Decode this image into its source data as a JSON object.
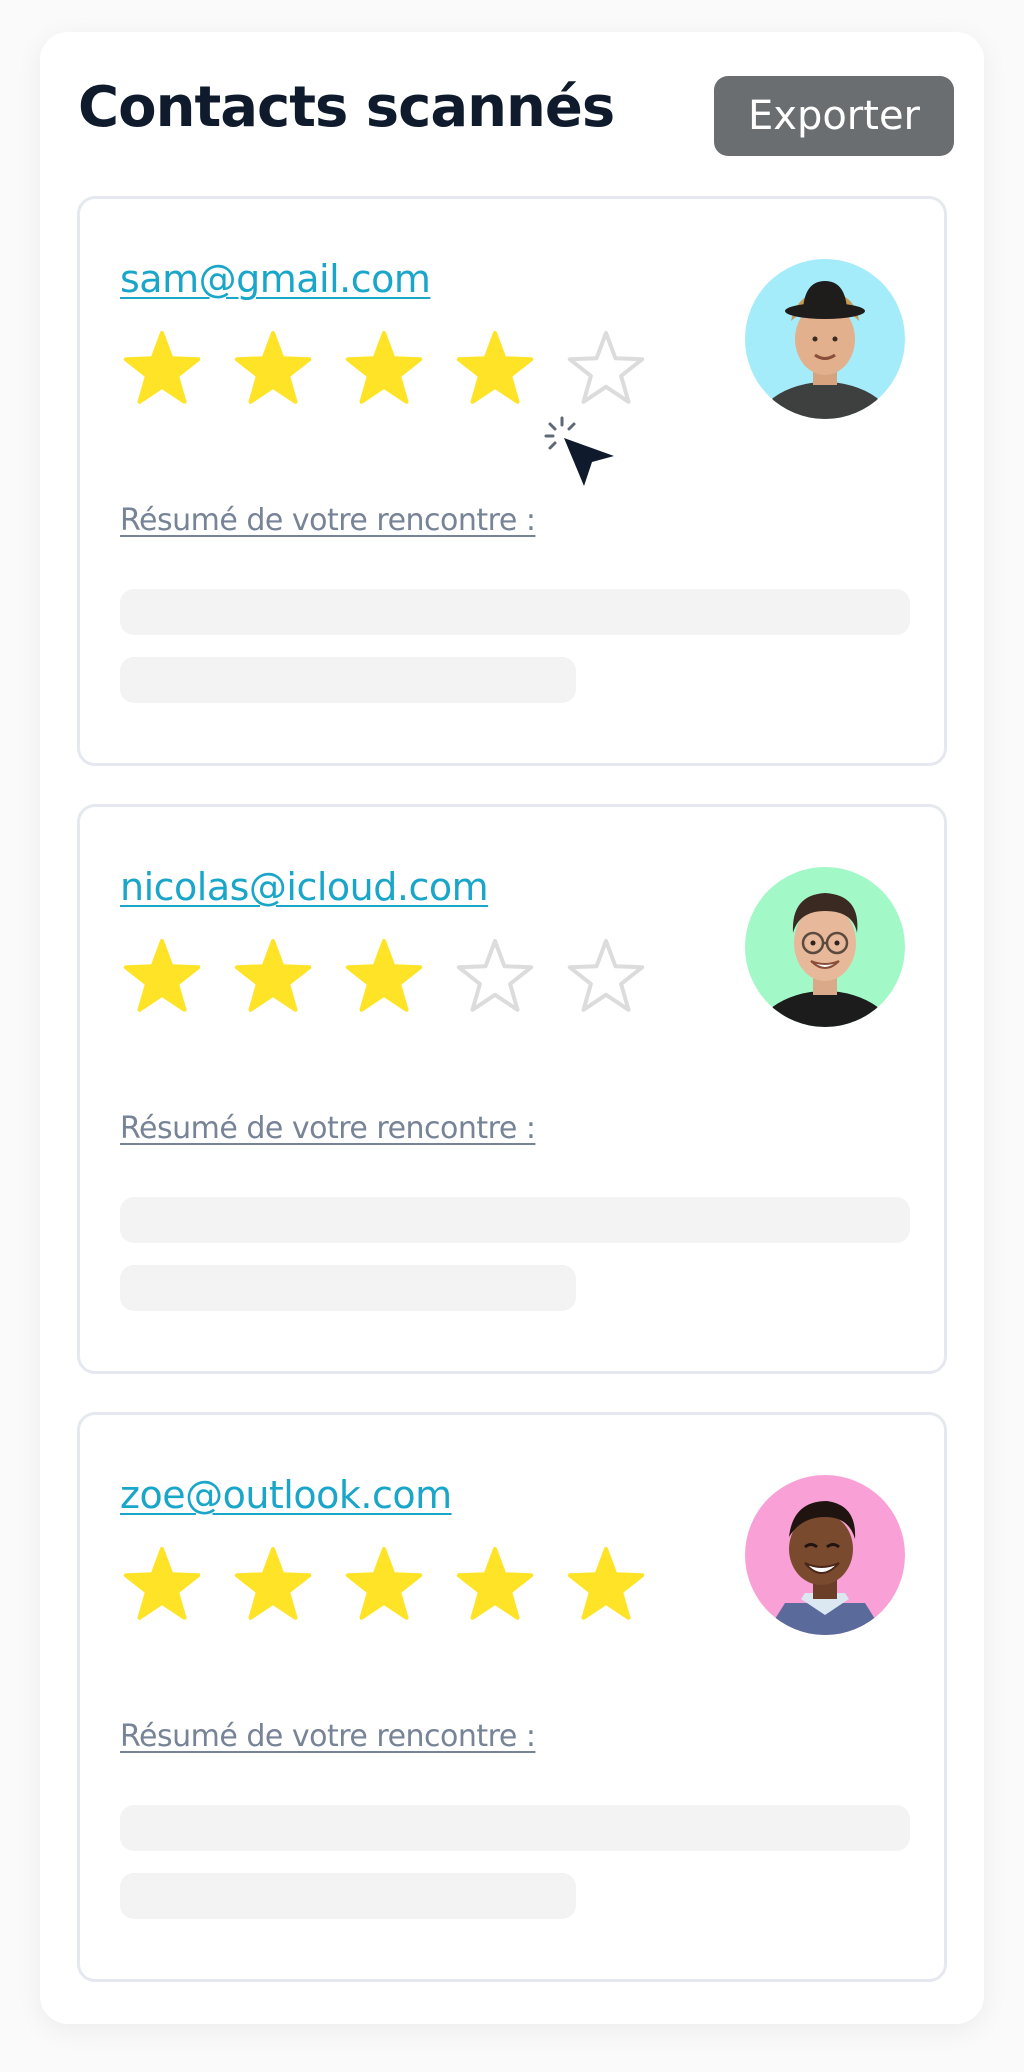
{
  "header": {
    "title": "Contacts scannés",
    "export_label": "Exporter"
  },
  "contacts": [
    {
      "email": "sam@gmail.com",
      "rating": 4,
      "max_rating": 5,
      "summary_label": "Résumé de votre rencontre :",
      "avatar_bg": "#a5ecfb"
    },
    {
      "email": "nicolas@icloud.com",
      "rating": 3,
      "max_rating": 5,
      "summary_label": "Résumé de votre rencontre :",
      "avatar_bg": "#a3f8c8"
    },
    {
      "email": "zoe@outlook.com",
      "rating": 5,
      "max_rating": 5,
      "summary_label": "Résumé de votre rencontre :",
      "avatar_bg": "#f9a1d6"
    }
  ],
  "icons": {
    "star_filled": "star-filled-icon",
    "star_empty": "star-empty-icon",
    "cursor": "mouse-pointer-icon"
  },
  "colors": {
    "star_filled": "#fee327",
    "star_empty_stroke": "#dcdcdc",
    "link": "#1aa6c9",
    "title": "#0f1b2d",
    "button_bg": "#6b6e70"
  }
}
